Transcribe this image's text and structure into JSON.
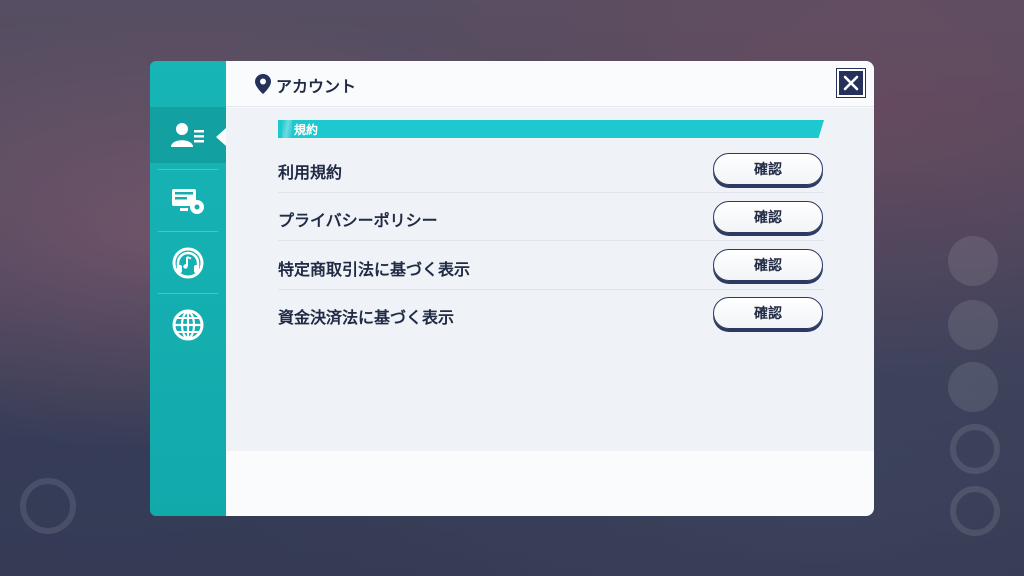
{
  "header": {
    "title": "アカウント",
    "icon": "map-pin-icon"
  },
  "sidebar": {
    "items": [
      {
        "icon": "account-icon",
        "active": true
      },
      {
        "icon": "display-settings-icon",
        "active": false
      },
      {
        "icon": "audio-headphones-icon",
        "active": false
      },
      {
        "icon": "globe-language-icon",
        "active": false
      }
    ]
  },
  "section": {
    "title": "規約"
  },
  "rows": [
    {
      "label": "利用規約",
      "button": "確認"
    },
    {
      "label": "プライバシーポリシー",
      "button": "確認"
    },
    {
      "label": "特定商取引法に基づく表示",
      "button": "確認"
    },
    {
      "label": "資金決済法に基づく表示",
      "button": "確認"
    }
  ],
  "colors": {
    "accent": "#1ec8cf",
    "sidebar": "#17b5b6",
    "navy": "#25315a"
  }
}
